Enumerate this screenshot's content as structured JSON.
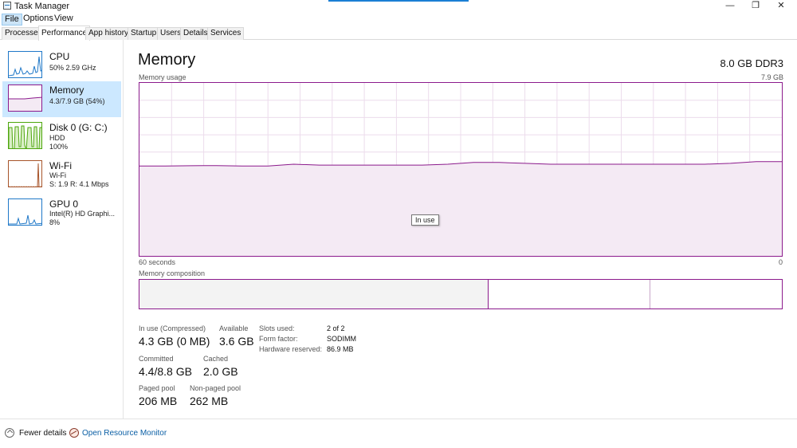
{
  "window": {
    "title": "Task Manager",
    "minimize": "—",
    "restore": "❐",
    "close": "✕"
  },
  "menu": [
    "File",
    "Options",
    "View"
  ],
  "tabs": [
    "Processes",
    "Performance",
    "App history",
    "Startup",
    "Users",
    "Details",
    "Services"
  ],
  "sidebar": [
    {
      "name": "CPU",
      "lines": [
        "50% 2.59 GHz"
      ]
    },
    {
      "name": "Memory",
      "lines": [
        "4.3/7.9 GB (54%)"
      ]
    },
    {
      "name": "Disk 0 (G: C:)",
      "lines": [
        "HDD",
        "100%"
      ]
    },
    {
      "name": "Wi-Fi",
      "lines": [
        "Wi-Fi",
        "S: 1.9 R: 4.1 Mbps"
      ]
    },
    {
      "name": "GPU 0",
      "lines": [
        "Intel(R) HD Graphi...",
        "8%"
      ]
    }
  ],
  "main": {
    "title": "Memory",
    "spec": "8.0 GB DDR3",
    "usage_label": "Memory usage",
    "usage_max": "7.9 GB",
    "time_left": "60 seconds",
    "time_right": "0",
    "tooltip": "In use",
    "composition_label": "Memory composition",
    "usage_fraction": [
      0.52,
      0.52,
      0.521,
      0.522,
      0.52,
      0.52,
      0.53,
      0.525,
      0.525,
      0.525,
      0.525,
      0.525,
      0.53,
      0.54,
      0.54,
      0.535,
      0.53,
      0.53,
      0.53,
      0.53,
      0.53,
      0.53,
      0.53,
      0.535,
      0.545,
      0.545
    ]
  },
  "stats": {
    "in_use_label": "In use (Compressed)",
    "in_use_value": "4.3 GB (0 MB)",
    "available_label": "Available",
    "available_value": "3.6 GB",
    "committed_label": "Committed",
    "committed_value": "4.4/8.8 GB",
    "cached_label": "Cached",
    "cached_value": "2.0 GB",
    "paged_label": "Paged pool",
    "paged_value": "206 MB",
    "nonpaged_label": "Non-paged pool",
    "nonpaged_value": "262 MB",
    "slots_label": "Slots used:",
    "slots_value": "2 of 2",
    "form_label": "Form factor:",
    "form_value": "SODIMM",
    "hw_label": "Hardware reserved:",
    "hw_value": "86.9 MB"
  },
  "footer": {
    "fewer_details": "Fewer details",
    "open_monitor": "Open Resource Monitor"
  },
  "colors": {
    "memory_accent": "#8b1a8c",
    "selected_bg": "#cce8ff",
    "link": "#0b5fa5"
  }
}
